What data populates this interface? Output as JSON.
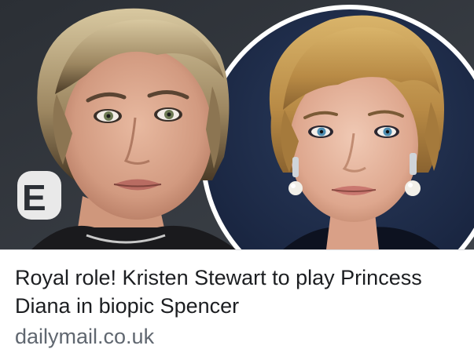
{
  "link_preview": {
    "headline": "Royal role! Kristen Stewart to play Princess Diana in biopic Spencer",
    "domain": "dailymail.co.uk",
    "image": {
      "left_subject": "portrait-short-blonde-hair",
      "right_subject": "portrait-royal-with-pearl-earrings",
      "background_logo_fragment": "E"
    }
  },
  "colors": {
    "headline_text": "#1c1e21",
    "domain_text": "#606770",
    "image_background": "#2f3338",
    "right_circle_background": "#1d2c46",
    "divider": "#d9dadd"
  }
}
